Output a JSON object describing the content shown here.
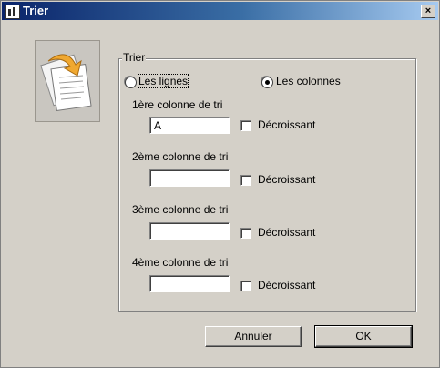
{
  "window": {
    "title": "Trier",
    "close_glyph": "×"
  },
  "illustration": {
    "icon": "sort-documents-icon"
  },
  "group": {
    "label": "Trier"
  },
  "orientation": {
    "rows_label": "Les lignes",
    "columns_label": "Les colonnes",
    "selected": "columns"
  },
  "sort_keys": [
    {
      "label": "1ère colonne de tri",
      "value": "A",
      "descending_label": "Décroissant",
      "descending": false
    },
    {
      "label": "2ème colonne de tri",
      "value": "",
      "descending_label": "Décroissant",
      "descending": false
    },
    {
      "label": "3ème colonne de tri",
      "value": "",
      "descending_label": "Décroissant",
      "descending": false
    },
    {
      "label": "4ème colonne de tri",
      "value": "",
      "descending_label": "Décroissant",
      "descending": false
    }
  ],
  "buttons": {
    "cancel": "Annuler",
    "ok": "OK"
  }
}
